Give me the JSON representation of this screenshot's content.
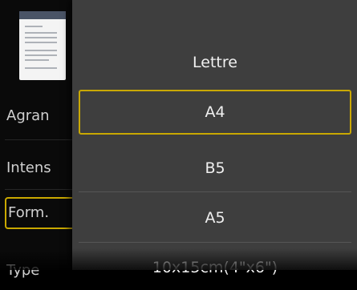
{
  "left_menu": {
    "items": [
      {
        "label": "Agran"
      },
      {
        "label": "Intens"
      },
      {
        "label": "Form."
      },
      {
        "label": "Type"
      }
    ],
    "selected_index": 2
  },
  "dropdown": {
    "options": [
      {
        "label": "Lettre"
      },
      {
        "label": "A4"
      },
      {
        "label": "B5"
      },
      {
        "label": "A5"
      },
      {
        "label": "10x15cm(4\"x6\")"
      }
    ],
    "selected_value": "A4"
  },
  "colors": {
    "selection_outline": "#c9a800",
    "panel_background": "#3e3e3e"
  }
}
